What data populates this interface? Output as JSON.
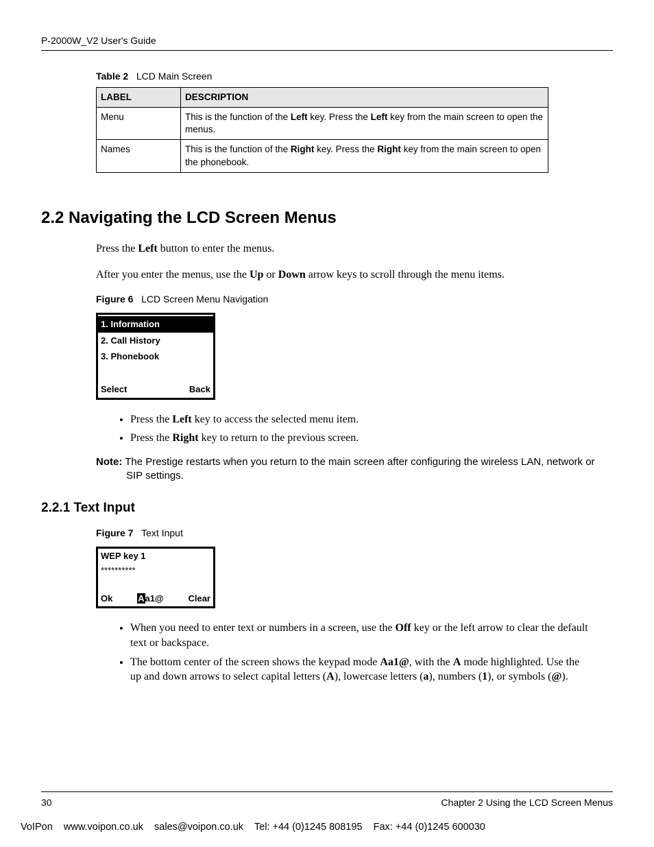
{
  "runningHead": "P-2000W_V2 User's Guide",
  "tableCaption": {
    "label": "Table 2",
    "title": "LCD Main Screen"
  },
  "table": {
    "headers": [
      "LABEL",
      "DESCRIPTION"
    ],
    "rows": [
      {
        "label": "Menu",
        "desc": {
          "pre": "This is the function of the ",
          "b1": "Left",
          "mid": " key. Press the ",
          "b2": "Left",
          "post": " key from the main screen to open the menus."
        }
      },
      {
        "label": "Names",
        "desc": {
          "pre": "This is the function of the ",
          "b1": "Right",
          "mid": " key. Press the ",
          "b2": "Right",
          "post": " key from the main screen to open the phonebook."
        }
      }
    ]
  },
  "section": {
    "heading": "2.2  Navigating the LCD Screen Menus",
    "p1": {
      "pre": "Press the ",
      "b": "Left",
      "post": " button to enter the menus."
    },
    "p2": {
      "pre": "After you enter the menus, use the ",
      "b1": "Up",
      "mid": " or ",
      "b2": "Down",
      "post": " arrow keys to scroll through the menu items."
    }
  },
  "fig6": {
    "caption": {
      "label": "Figure 6",
      "title": "LCD Screen Menu Navigation"
    },
    "items": [
      "1. Information",
      "2. Call History",
      "3. Phonebook"
    ],
    "softkeys": [
      "Select",
      "Back"
    ]
  },
  "list1": [
    {
      "pre": "Press the ",
      "b": "Left",
      "post": " key to access the selected menu item."
    },
    {
      "pre": "Press the ",
      "b": "Right",
      "post": " key to return to the previous screen."
    }
  ],
  "note": {
    "label": "Note:",
    "text": " The Prestige restarts when you return to the main screen after configuring the wireless LAN, network or SIP settings."
  },
  "subsection": {
    "heading": "2.2.1  Text Input"
  },
  "fig7": {
    "caption": {
      "label": "Figure 7",
      "title": "Text Input"
    },
    "title": "WEP key 1",
    "value": "**********",
    "softLeft": "Ok",
    "modeSel": "A",
    "modeRest": "a1@",
    "softRight": "Clear"
  },
  "list2": [
    {
      "t0": "When you need to enter text or numbers in a screen, use the ",
      "b1": "Off",
      "t1": " key or the left arrow to clear the default text or backspace."
    },
    {
      "t0": "The bottom center of the screen shows the keypad mode ",
      "b1": "Aa1@",
      "t1": ", with the ",
      "b2": "A",
      "t2": " mode highlighted. Use the up and down arrows to select capital letters (",
      "b3": "A",
      "t3": "), lowercase letters (",
      "b4": "a",
      "t4": "), numbers (",
      "b5": "1",
      "t5": "), or symbols (",
      "b6": "@",
      "t6": ")."
    }
  ],
  "footer": {
    "pageNum": "30",
    "chapter": "Chapter 2 Using the LCD Screen Menus"
  },
  "voip": "VoIPon    www.voipon.co.uk    sales@voipon.co.uk    Tel: +44 (0)1245 808195    Fax: +44 (0)1245 600030"
}
